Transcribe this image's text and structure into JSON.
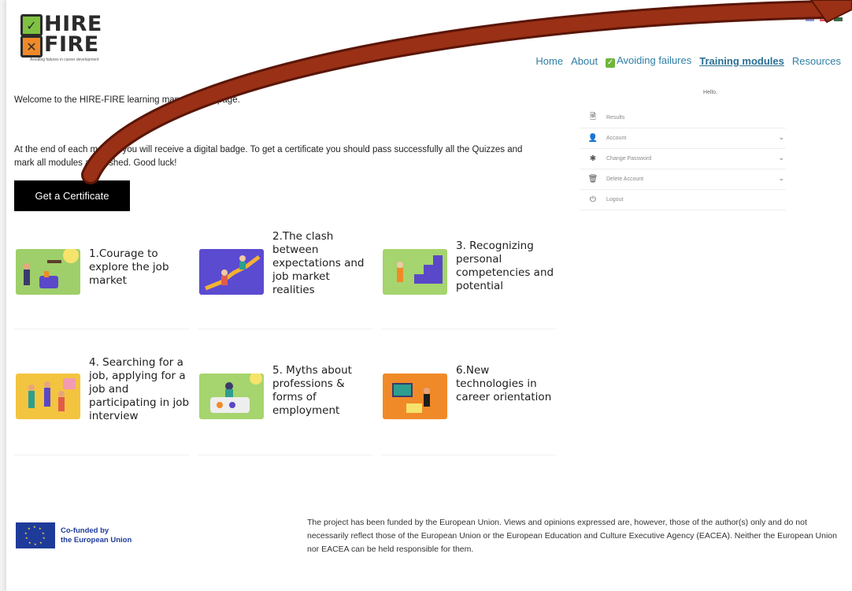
{
  "logo": {
    "line1": "HIRE",
    "line2": "FIRE",
    "tagline": "Avoiding failures in career development"
  },
  "nav": {
    "items": [
      "Home",
      "About",
      "Avoiding failures",
      "Training modules",
      "Resources"
    ]
  },
  "welcome": "Welcome to the HIRE-FIRE learning management page.",
  "intro": "At the end of each module you will receive a digital badge. To get a certificate you should pass successfully all the Quizzes and mark all modules as finished. Good luck!",
  "cert_button": "Get a Certificate",
  "side_menu": {
    "greeting": "Hello,",
    "items": [
      "Results",
      "Account",
      "Change Password",
      "Delete Account",
      "Logout"
    ]
  },
  "modules": [
    "1.Courage to explore the job market",
    "2.The clash between expectations and job market realities",
    "3. Recognizing personal competencies and potential",
    "4. Searching for a job, applying for a job and participating in job interview",
    "5. Myths about professions & forms of employment",
    "6.New technologies in career orientation"
  ],
  "footer": {
    "eu_line1": "Co-funded by",
    "eu_line2": "the European Union",
    "disclaimer": "The project has been funded by the European Union. Views and opinions expressed are, however, those of the author(s) only and do not necessarily reflect those of the European Union or the European Education and Culture Executive Agency (EACEA). Neither the European Union nor EACEA can be held responsible for them."
  },
  "colors": {
    "nav_link": "#2f7fa6",
    "check_green": "#7ec242",
    "cross_orange": "#f08a28",
    "eu_blue": "#1f3b9a",
    "arrow_brown": "#8b2a14"
  },
  "icons": {
    "results": "document-icon",
    "account": "user-icon",
    "change_password": "asterisk-icon",
    "delete_account": "trash-icon",
    "logout": "power-icon"
  }
}
